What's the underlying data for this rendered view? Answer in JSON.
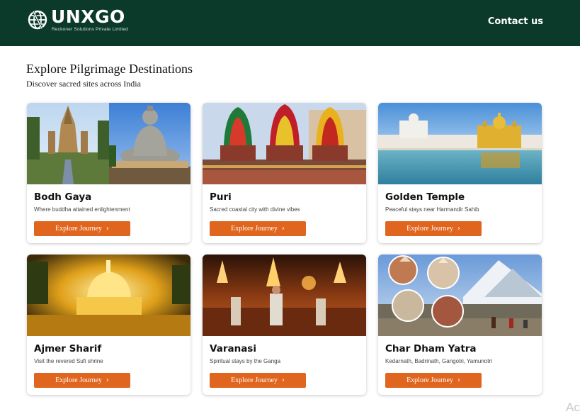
{
  "header": {
    "logo_text": "UNXGO",
    "logo_subtitle": "Reckoner Solutions Private Limited",
    "contact_label": "Contact us"
  },
  "main": {
    "title": "Explore Pilgrimage Destinations",
    "subtitle": "Discover sacred sites across India"
  },
  "cards": [
    {
      "title": "Bodh Gaya",
      "description": "Where buddha attained enlightenment",
      "button": "Explore Journey"
    },
    {
      "title": "Puri",
      "description": "Sacred coastal city with divine vibes",
      "button": "Explore Journey"
    },
    {
      "title": "Golden Temple",
      "description": "Peaceful stays near Harmandir Sahib",
      "button": "Explore Journey"
    },
    {
      "title": "Ajmer Sharif",
      "description": "Visit the revered Sufi shrine",
      "button": "Explore Journey"
    },
    {
      "title": "Varanasi",
      "description": "Spiritual stays by the Ganga",
      "button": "Explore Journey"
    },
    {
      "title": "Char Dham Yatra",
      "description": "Kedarnath, Badrinath, Gangotri, Yamunotri",
      "button": "Explore Journey"
    }
  ],
  "icons": {
    "logo": "globe-icon",
    "button": "chevron-right-icon"
  },
  "colors": {
    "header_bg": "#0b3a2a",
    "button_bg": "#e0651e"
  },
  "corner_text": "Ac"
}
